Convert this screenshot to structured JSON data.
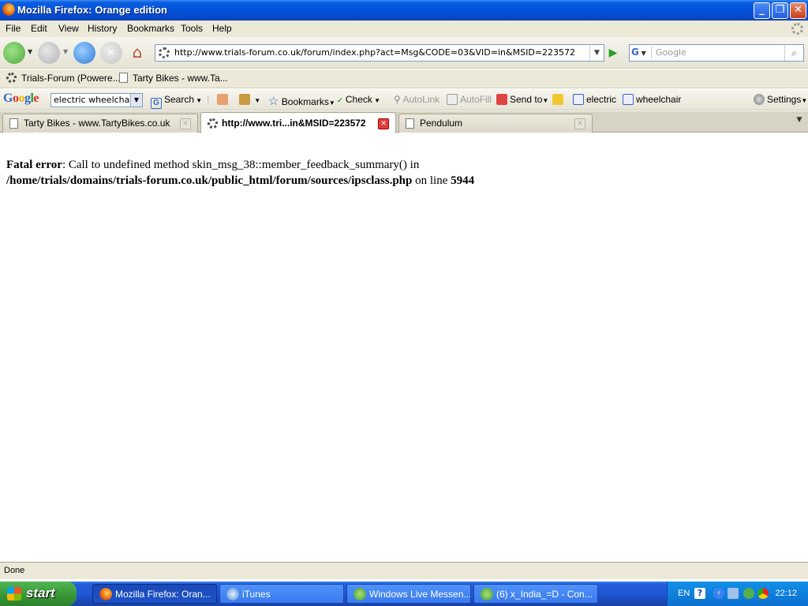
{
  "window": {
    "title": "Mozilla Firefox: Orange edition"
  },
  "menu": [
    "File",
    "Edit",
    "View",
    "History",
    "Bookmarks",
    "Tools",
    "Help"
  ],
  "nav": {
    "url": "http://www.trials-forum.co.uk/forum/index.php?act=Msg&CODE=03&VID=in&MSID=223572",
    "search_placeholder": "Google",
    "search_engine_letter": "G"
  },
  "bookmarks": [
    "Trials-Forum (Powere...",
    "Tarty Bikes - www.Ta..."
  ],
  "google_toolbar": {
    "logo": "Google",
    "query": "electric wheelchair",
    "search": "Search",
    "bookmarks": "Bookmarks",
    "check": "Check",
    "autolink": "AutoLink",
    "autofill": "AutoFill",
    "sendto": "Send to",
    "term1": "electric",
    "term2": "wheelchair",
    "settings": "Settings"
  },
  "tabs": [
    {
      "label": "Tarty Bikes - www.TartyBikes.co.uk",
      "active": false
    },
    {
      "label": "http://www.tri...in&MSID=223572",
      "active": true
    },
    {
      "label": "Pendulum",
      "active": false
    }
  ],
  "content": {
    "error_label": "Fatal error",
    "error_text": ": Call to undefined method skin_msg_38::member_feedback_summary() in",
    "error_path": "/home/trials/domains/trials-forum.co.uk/public_html/forum/sources/ipsclass.php",
    "error_online": " on line ",
    "error_line": "5944"
  },
  "status": "Done",
  "taskbar": {
    "start": "start",
    "tasks": [
      {
        "label": "Mozilla Firefox: Oran...",
        "active": true
      },
      {
        "label": "iTunes",
        "active": false
      },
      {
        "label": "Windows Live Messen...",
        "active": false
      },
      {
        "label": "(6) x_India_=D - Con...",
        "active": false
      }
    ],
    "lang": "EN",
    "clock": "22:12"
  },
  "colors": {
    "xp_blue": "#0050d8",
    "start_green": "#3a9a3a",
    "error_close": "#e23b3b"
  }
}
